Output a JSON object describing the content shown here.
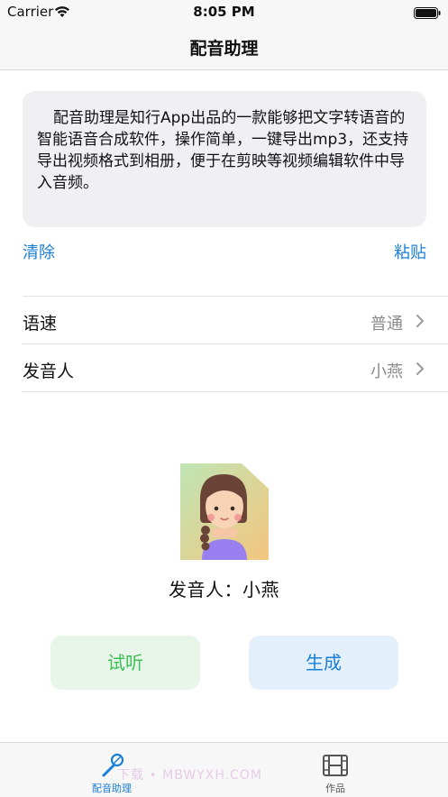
{
  "status_bar": {
    "carrier": "Carrier",
    "time": "8:05 PM"
  },
  "nav": {
    "title": "配音助理"
  },
  "text_box": {
    "content": "配音助理是知行App出品的一款能够把文字转语音的智能语音合成软件，操作简单，一键导出mp3，还支持导出视频格式到相册，便于在剪映等视频编辑软件中导入音频。"
  },
  "actions": {
    "clear": "清除",
    "paste": "粘贴"
  },
  "settings": [
    {
      "label": "语速",
      "value": "普通"
    },
    {
      "label": "发音人",
      "value": "小燕"
    }
  ],
  "speaker": {
    "prefix": "发音人：",
    "name": "小燕"
  },
  "buttons": {
    "listen": "试听",
    "generate": "生成"
  },
  "tabs": [
    {
      "label": "配音助理",
      "icon": "microphone-icon",
      "active": true
    },
    {
      "label": "作品",
      "icon": "film-icon",
      "active": false
    }
  ],
  "watermark": "下载 • MBWYXH.COM",
  "colors": {
    "accent": "#1a7fd6",
    "listen": "#3dbf57",
    "listen_bg": "#e8f6e9",
    "generate_bg": "#e3f0fb"
  }
}
